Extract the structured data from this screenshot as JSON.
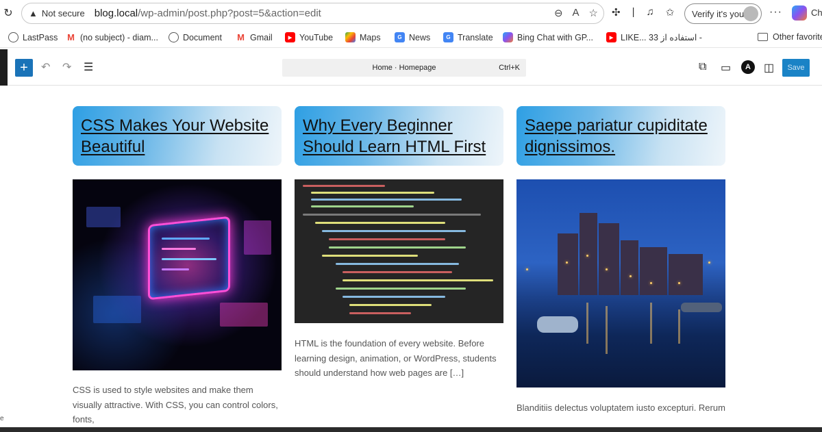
{
  "browser": {
    "not_secure": "Not secure",
    "url_host": "blog.local",
    "url_path": "/wp-admin/post.php?post=5&action=edit",
    "verify_label": "Verify it's you",
    "copilot_label": "Ch",
    "bookmarks": [
      {
        "label": "LastPass",
        "icon": "globe-icon",
        "color": "#555555"
      },
      {
        "label": "(no subject) - diam...",
        "icon": "gmail-icon",
        "color": "#ea4335"
      },
      {
        "label": "Document",
        "icon": "globe-icon",
        "color": "#555555"
      },
      {
        "label": "Gmail",
        "icon": "gmail-icon",
        "color": "#ea4335"
      },
      {
        "label": "YouTube",
        "icon": "youtube-icon",
        "color": "#ff0000"
      },
      {
        "label": "Maps",
        "icon": "maps-icon",
        "color": "#34a853"
      },
      {
        "label": "News",
        "icon": "news-icon",
        "color": "#4285f4"
      },
      {
        "label": "Translate",
        "icon": "translate-icon",
        "color": "#4285f4"
      },
      {
        "label": "Bing Chat with GP...",
        "icon": "copilot-icon",
        "color": "#8a52f0"
      },
      {
        "label": "LIKE... استفاده از 33 -",
        "icon": "youtube-icon",
        "color": "#ff0000"
      }
    ],
    "other_favorites": "Other favorite"
  },
  "editor": {
    "document_title": "Home · Homepage",
    "shortcut": "Ctrl+K",
    "save_label": "Save",
    "accent": "#1a73b8"
  },
  "posts": [
    {
      "title": "CSS Makes Your Website Beautiful",
      "excerpt": "CSS is used to style websites and make them visually attractive. With CSS, you can control colors, fonts,"
    },
    {
      "title": "Why Every Beginner Should Learn HTML First",
      "excerpt": "HTML is the foundation of every website. Before learning design, animation, or WordPress, students should understand how web pages are […]"
    },
    {
      "title": "Saepe pariatur cupiditate dignissimos.",
      "excerpt": "Blanditiis delectus voluptatem iusto excepturi. Rerum"
    }
  ]
}
